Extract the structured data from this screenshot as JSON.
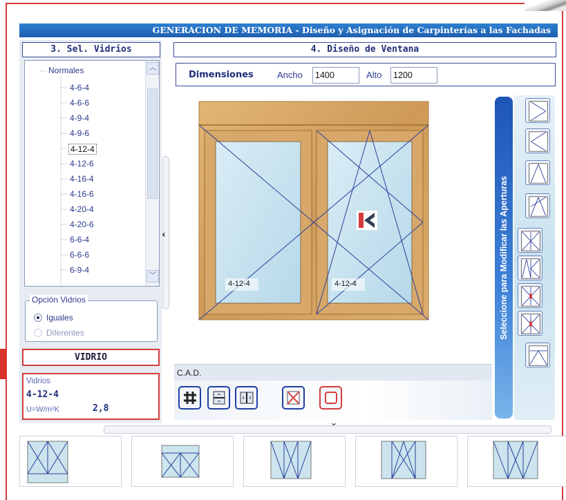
{
  "header": {
    "title": "GENERACION DE MEMORIA - Diseño y Asignación de Carpinterías a las Fachadas"
  },
  "left_panel": {
    "title": "3. Sel. Vidrios",
    "tree": {
      "root": "Normales",
      "items": [
        "4-6-4",
        "4-6-6",
        "4-9-4",
        "4-9-6",
        "4-12-4",
        "4-12-6",
        "4-16-4",
        "4-16-6",
        "4-20-4",
        "4-20-6",
        "6-6-4",
        "6-6-6",
        "6-9-4"
      ],
      "selected": "4-12-4"
    },
    "options": {
      "legend": "Opción Vidrios",
      "option1": "Iguales",
      "option2": "Diferentes",
      "selected": "Iguales"
    },
    "vidrio": {
      "header": "VIDRIO",
      "label": "Vidrios",
      "value": "4-12-4",
      "u_label": "U=W/m²K",
      "u_value": "2,8"
    }
  },
  "right_panel": {
    "title": "4. Diseño de Ventana",
    "dimensions": {
      "label": "Dimensiones",
      "ancho_label": "Ancho",
      "ancho_value": "1400",
      "alto_label": "Alto",
      "alto_value": "1200"
    },
    "window": {
      "left_glass": "4-12-4",
      "right_glass": "4-12-4"
    },
    "cad_label": "C.A.D.",
    "openings_label": "Seleccione para Modificar las Aperturas"
  },
  "colors": {
    "accent_blue": "#1e5fae",
    "frame_wood": "#d7a86a",
    "glass": "#cfe6f1",
    "highlight_red": "#d33b3b"
  }
}
